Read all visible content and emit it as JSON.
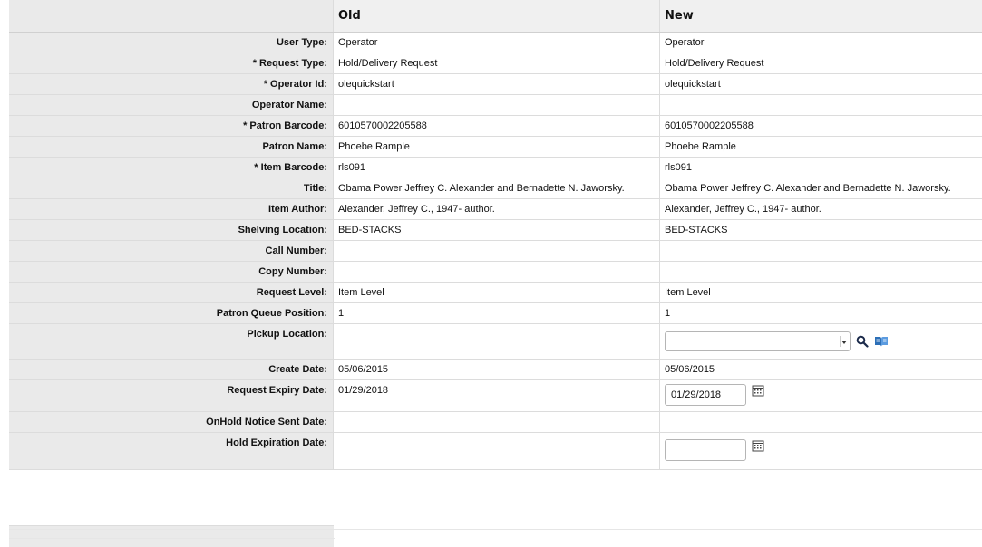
{
  "header": {
    "old": "Old",
    "new": "New"
  },
  "rows": [
    {
      "label": "User Type:",
      "old": "Operator",
      "new": "Operator"
    },
    {
      "label": "* Request Type:",
      "old": "Hold/Delivery Request",
      "new": "Hold/Delivery Request"
    },
    {
      "label": "* Operator Id:",
      "old": "olequickstart",
      "new": "olequickstart"
    },
    {
      "label": "Operator Name:",
      "old": "",
      "new": ""
    },
    {
      "label": "* Patron Barcode:",
      "old": "6010570002205588",
      "new": "6010570002205588"
    },
    {
      "label": "Patron Name:",
      "old": "Phoebe Rample",
      "new": "Phoebe Rample"
    },
    {
      "label": "* Item Barcode:",
      "old": "rls091",
      "new": "rls091"
    },
    {
      "label": "Title:",
      "old": "Obama Power Jeffrey C. Alexander and Bernadette N. Jaworsky.",
      "new": "Obama Power Jeffrey C. Alexander and Bernadette N. Jaworsky."
    },
    {
      "label": "Item Author:",
      "old": "Alexander, Jeffrey C., 1947- author.",
      "new": "Alexander, Jeffrey C., 1947- author."
    },
    {
      "label": "Shelving Location:",
      "old": "BED-STACKS",
      "new": "BED-STACKS"
    },
    {
      "label": "Call Number:",
      "old": "",
      "new": ""
    },
    {
      "label": "Copy Number:",
      "old": "",
      "new": ""
    },
    {
      "label": "Request Level:",
      "old": "Item Level",
      "new": "Item Level"
    },
    {
      "label": "Patron Queue Position:",
      "old": "1",
      "new": "1"
    }
  ],
  "pickup": {
    "label": "Pickup Location:",
    "old": "",
    "selected": ""
  },
  "create_date": {
    "label": "Create Date:",
    "old": "05/06/2015",
    "new": "05/06/2015"
  },
  "expiry": {
    "label": "Request Expiry Date:",
    "old": "01/29/2018",
    "value": "01/29/2018"
  },
  "onhold": {
    "label": "OnHold Notice Sent Date:",
    "old": "",
    "new": ""
  },
  "hold_exp": {
    "label": "Hold Expiration Date:",
    "old": "",
    "value": ""
  },
  "icons": {
    "search": "search-icon",
    "book": "book-icon",
    "calendar": "calendar-icon"
  }
}
